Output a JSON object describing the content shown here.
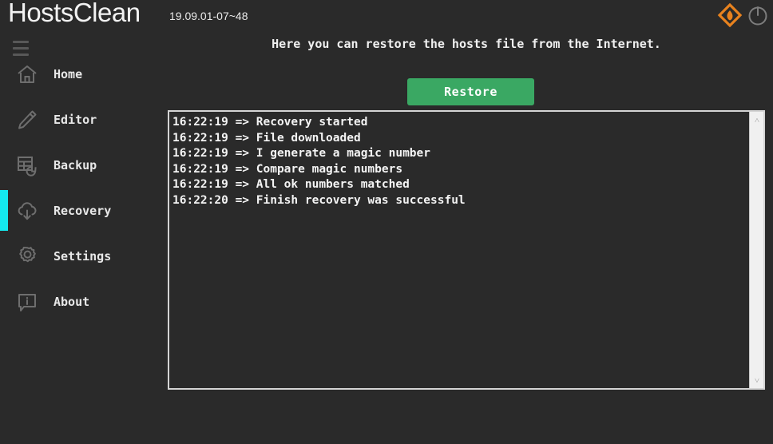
{
  "app": {
    "title": "HostsClean",
    "version": "19.09.01-07~48"
  },
  "topbar": {
    "logo_icon": "flame-diamond-logo-icon",
    "power_icon": "power-icon",
    "menu_icon": "hamburger-menu-icon"
  },
  "colors": {
    "background": "#2a2a2a",
    "accent_cyan": "#14eaf0",
    "brand_orange": "#e8821e",
    "restore_green": "#3aa863",
    "text_primary": "#f0f0f0",
    "icon_gray": "#6e6e6e",
    "scrollbar_track": "#f0f0f0",
    "log_border": "#d4d4d4"
  },
  "sidebar": {
    "items": [
      {
        "label": "Home",
        "icon": "home-icon",
        "active": false
      },
      {
        "label": "Editor",
        "icon": "pencil-icon",
        "active": false
      },
      {
        "label": "Backup",
        "icon": "database-restore-icon",
        "active": false
      },
      {
        "label": "Recovery",
        "icon": "cloud-download-icon",
        "active": true
      },
      {
        "label": "Settings",
        "icon": "gear-icon",
        "active": false
      },
      {
        "label": "About",
        "icon": "info-bubble-icon",
        "active": false
      }
    ]
  },
  "main": {
    "subtitle": "Here you can restore the hosts file from the Internet.",
    "restore_label": "Restore",
    "log_lines": [
      "16:22:19 => Recovery started",
      "16:22:19 => File downloaded",
      "16:22:19 => I generate a magic number",
      "16:22:19 => Compare magic numbers",
      "16:22:19 => All ok numbers matched",
      "16:22:20 => Finish recovery was successful"
    ],
    "scrollbar": {
      "up_arrow": "˄",
      "down_arrow": "˅"
    }
  }
}
